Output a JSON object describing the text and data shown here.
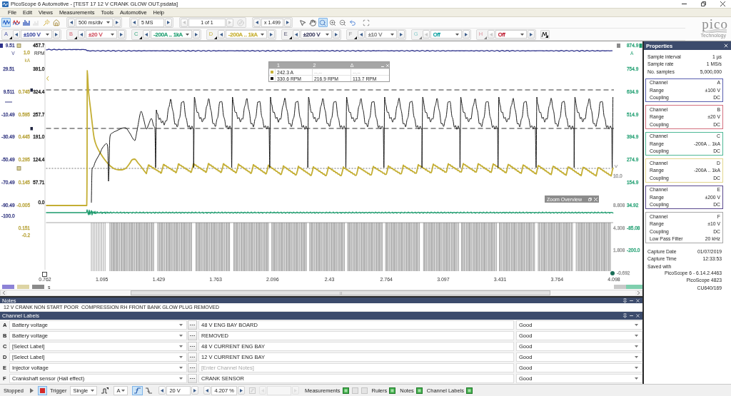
{
  "window": {
    "title": "PicoScope 6 Automotive - [TEST 17 12 V CRANK GLOW OUT.psdata]"
  },
  "menu": [
    "File",
    "Edit",
    "Views",
    "Measurements",
    "Tools",
    "Automotive",
    "Help"
  ],
  "toolbar": {
    "views": [
      {
        "kind": "scope",
        "selected": true,
        "disabled": false
      },
      {
        "kind": "persistence",
        "selected": false,
        "disabled": false
      },
      {
        "kind": "spectrum",
        "selected": false,
        "disabled": false
      },
      {
        "kind": "xy",
        "selected": false,
        "disabled": true
      },
      {
        "kind": "autosetup",
        "selected": false,
        "disabled": false
      },
      {
        "kind": "home",
        "selected": false,
        "disabled": false
      }
    ],
    "timebase": "500 ms/div",
    "samples": "5 MS",
    "buffer": "1 of 1",
    "buffer_nav_enabled": false,
    "zoom_factor": "x 1.499",
    "tools": [
      {
        "kind": "pointer",
        "selected": false
      },
      {
        "kind": "hand",
        "selected": false
      },
      {
        "kind": "zoom",
        "selected": true
      },
      {
        "kind": "zoom-in",
        "selected": false
      },
      {
        "kind": "zoom-out",
        "selected": false
      },
      {
        "kind": "undo",
        "selected": false
      },
      {
        "kind": "fit",
        "selected": false
      }
    ]
  },
  "channels": [
    {
      "letter": "A",
      "range": "±100 V",
      "color": "#4a56a6",
      "enabled": true
    },
    {
      "letter": "B",
      "range": "±20 V",
      "color": "#d4606e",
      "enabled": true
    },
    {
      "letter": "C",
      "range": "-200A .. 1kA",
      "color": "#2ea57a",
      "enabled": true
    },
    {
      "letter": "D",
      "range": "-200A .. 1kA",
      "color": "#c9b33c",
      "enabled": true
    },
    {
      "letter": "E",
      "range": "±200 V",
      "color": "#4a4a6a",
      "enabled": true
    },
    {
      "letter": "F",
      "range": "±10 V",
      "color": "#8c8c8c",
      "enabled": true
    },
    {
      "letter": "G",
      "range": "Off",
      "color": "#19a5a5",
      "enabled": false
    },
    {
      "letter": "H",
      "range": "Off",
      "color": "#c22a3e",
      "enabled": false
    }
  ],
  "logo": {
    "name": "pico",
    "tagline": "Technology"
  },
  "scope": {
    "left_axes": [
      {
        "unit": "V",
        "color": "#3b3f86",
        "ticks": [
          "9.51",
          "29.51",
          "9.511",
          "-10.49",
          "-30.49",
          "-50.49",
          "-70.49",
          "-90.49",
          "-100.0"
        ]
      },
      {
        "unit": "kA",
        "color": "#b9a53e",
        "ticks": [
          "1.0",
          "0.745",
          "0.595",
          "0.445",
          "0.295",
          "0.145",
          "-0.005",
          "0.151",
          "-0.2"
        ]
      },
      {
        "unit": "RPM",
        "color": "#1e1e1e",
        "ticks": [
          "457.7",
          "391.0",
          "324.4",
          "257.7",
          "191.0",
          "124.4",
          "57.71",
          "0.0"
        ]
      }
    ],
    "right_axes": [
      {
        "unit": "A",
        "color": "#2ea57a",
        "ticks": [
          "874.9",
          "754.9",
          "634.9",
          "514.9",
          "394.9",
          "274.9",
          "154.9",
          "34.92",
          "-85.08",
          "-200.0"
        ]
      },
      {
        "color": "#9a9a9a",
        "ticks": [
          "10.0",
          "8.808",
          "4.308",
          "1.808",
          "-0.692"
        ]
      }
    ],
    "time_axis": {
      "unit": "s",
      "ticks": [
        "0.762",
        "1.095",
        "1.429",
        "1.763",
        "2.096",
        "2.43",
        "2.764",
        "3.097",
        "3.431",
        "3.764",
        "4.098"
      ]
    },
    "ruler_table": {
      "columns": [
        "1",
        "2",
        "Δ"
      ],
      "rows": [
        {
          "color": "#c9b33c",
          "cells": [
            {
              "text": "242.3 A",
              "dimmed": false
            },
            {
              "text": "--.--",
              "dimmed": true
            },
            {
              "text": "--.--",
              "dimmed": true
            }
          ]
        },
        {
          "color": "#1e1e1e",
          "cells": [
            {
              "text": "330.6 RPM",
              "dimmed": false
            },
            {
              "text": "216.9 RPM",
              "dimmed": false
            },
            {
              "text": "113.7 RPM",
              "dimmed": false
            }
          ]
        }
      ]
    },
    "zoom_overview": {
      "title": "Zoom Overview"
    }
  },
  "notes": {
    "title": "Notes",
    "text": "12 V CRANK NON START POOR  COMPRESSION RH FRONT BANK GLOW PLUG REMOVED"
  },
  "channel_labels": {
    "title": "Channel Labels",
    "rows": [
      {
        "channel": "A",
        "label": "Battery voltage",
        "note": "48 V ENG BAY BOARD",
        "status": "Good"
      },
      {
        "channel": "B",
        "label": "Battery voltage",
        "note": "REMOVED",
        "status": "Good"
      },
      {
        "channel": "C",
        "label": "[Select Label]",
        "note": "48 V CURRENT ENG BAY",
        "status": "Good"
      },
      {
        "channel": "D",
        "label": "[Select Label]",
        "note": "12 V CURRENT ENG BAY",
        "status": "Good"
      },
      {
        "channel": "E",
        "label": "Injector voltage",
        "placeholder": "[Enter Channel Notes]",
        "status": "Good"
      },
      {
        "channel": "F",
        "label": "Crankshaft sensor (Hall effect)",
        "note": "CRANK SENSOR",
        "status": "Good"
      }
    ]
  },
  "properties": {
    "title": "Properties",
    "summary": [
      {
        "label": "Sample interval",
        "value": "1 µs"
      },
      {
        "label": "Sample rate",
        "value": "1 MS/s"
      },
      {
        "label": "No. samples",
        "value": "5,000,000"
      }
    ],
    "channels": [
      {
        "color": "#5a5fb0",
        "rows": [
          {
            "label": "Channel",
            "value": "A"
          },
          {
            "label": "Range",
            "value": "±100 V"
          },
          {
            "label": "Coupling",
            "value": "DC"
          }
        ]
      },
      {
        "color": "#d3707f",
        "rows": [
          {
            "label": "Channel",
            "value": "B"
          },
          {
            "label": "Range",
            "value": "±20 V"
          },
          {
            "label": "Coupling",
            "value": "DC"
          }
        ]
      },
      {
        "color": "#4fb896",
        "rows": [
          {
            "label": "Channel",
            "value": "C"
          },
          {
            "label": "Range",
            "value": "-200A .. 1kA"
          },
          {
            "label": "Coupling",
            "value": "DC"
          }
        ]
      },
      {
        "color": "#e3d68e",
        "rows": [
          {
            "label": "Channel",
            "value": "D"
          },
          {
            "label": "Range",
            "value": "-200A .. 1kA"
          },
          {
            "label": "Coupling",
            "value": "DC"
          }
        ]
      },
      {
        "color": "#5a4a8e",
        "rows": [
          {
            "label": "Channel",
            "value": "E"
          },
          {
            "label": "Range",
            "value": "±200 V"
          },
          {
            "label": "Coupling",
            "value": "DC"
          }
        ]
      },
      {
        "color": "#a8a8a8",
        "rows": [
          {
            "label": "Channel",
            "value": "F"
          },
          {
            "label": "Range",
            "value": "±10 V"
          },
          {
            "label": "Coupling",
            "value": "DC"
          },
          {
            "label": "Low Pass Filter",
            "value": "20 kHz"
          }
        ]
      }
    ],
    "capture": [
      {
        "label": "Capture Date",
        "value": "01/07/2019"
      },
      {
        "label": "Capture Time",
        "value": "12:33:53"
      }
    ],
    "saved_with_label": "Saved with",
    "saved_with": [
      "PicoScope 6 - 6.14.2.4463",
      "PicoScope 4823",
      "CU640/169"
    ]
  },
  "status_bar": {
    "state": "Stopped",
    "run_selected": false,
    "stop_selected": true,
    "trigger_label": "Trigger",
    "trigger_mode": "Single",
    "trigger_source": "A",
    "edges": [
      {
        "kind": "rising",
        "selected": true
      },
      {
        "kind": "falling",
        "selected": false
      }
    ],
    "threshold": "20 V",
    "pre_trigger": "4.207 %",
    "delay_enabled": false,
    "panels": [
      {
        "kind": "measurements",
        "label": "Measurements"
      },
      {
        "kind": "plain",
        "label": "Rulers"
      },
      {
        "kind": "plain",
        "label": "Notes"
      },
      {
        "kind": "plain",
        "label": "Channel Labels"
      }
    ]
  }
}
